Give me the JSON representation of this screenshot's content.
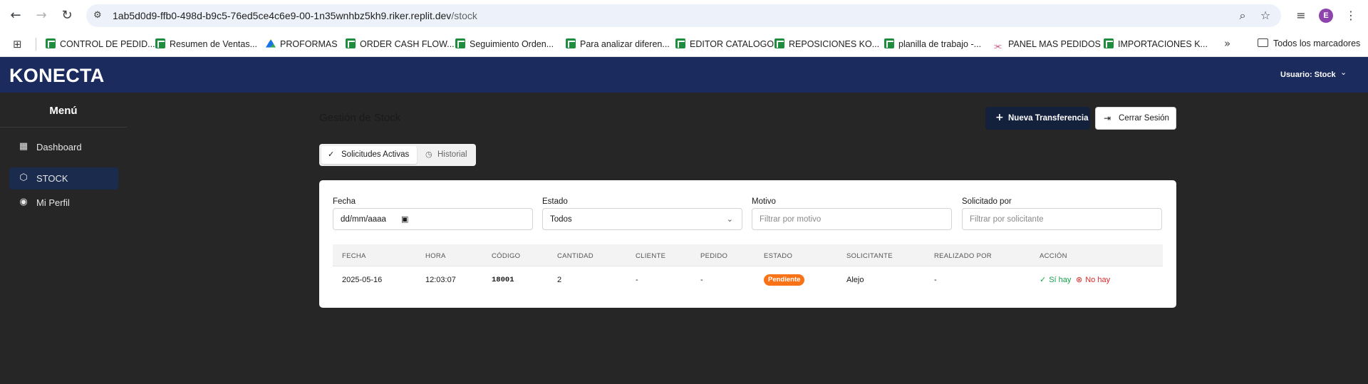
{
  "browser": {
    "url_host": "1ab5d0d9-ffb0-498d-b9c5-76ed5ce4c6e9-00-1n35wnhbz5kh9.riker.replit.dev",
    "url_path": "/stock",
    "avatar_letter": "E"
  },
  "bookmarks": {
    "items": [
      {
        "label": "CONTROL DE PEDID...",
        "icon": "sheets-icon"
      },
      {
        "label": "Resumen de Ventas...",
        "icon": "sheets-icon"
      },
      {
        "label": "PROFORMAS",
        "icon": "drive-icon"
      },
      {
        "label": "ORDER CASH FLOW...",
        "icon": "sheets-icon"
      },
      {
        "label": "Seguimiento Orden...",
        "icon": "sheets-icon"
      },
      {
        "label": "Para analizar diferen...",
        "icon": "sheets-icon"
      },
      {
        "label": "EDITOR CATALOGO",
        "icon": "sheets-icon"
      },
      {
        "label": "REPOSICIONES KO...",
        "icon": "sheets-icon"
      },
      {
        "label": "planilla de trabajo -...",
        "icon": "sheets-icon"
      },
      {
        "label": "PANEL MAS PEDIDOS",
        "icon": "panel-icon"
      },
      {
        "label": "IMPORTACIONES K...",
        "icon": "sheets-icon"
      }
    ],
    "all_bookmarks": "Todos los marcadores"
  },
  "header": {
    "logo": "KONECTA",
    "user_label": "Usuario: Stock",
    "brand_color": "#1b2b5e"
  },
  "sidebar": {
    "title": "Menú",
    "items": [
      {
        "label": "Dashboard",
        "icon": "dashboard-icon",
        "active": false
      },
      {
        "label": "STOCK",
        "icon": "box-icon",
        "active": true
      },
      {
        "label": "Mi Perfil",
        "icon": "user-circle-icon",
        "active": false
      }
    ]
  },
  "main": {
    "title": "Gestión de Stock",
    "new_transfer_label": "Nueva Transferencia",
    "logout_label": "Cerrar Sesión",
    "tabs": [
      {
        "label": "Solicitudes Activas",
        "active": true
      },
      {
        "label": "Historial",
        "active": false
      }
    ]
  },
  "filters": {
    "fecha": {
      "label": "Fecha",
      "value": "dd/mm/aaaa"
    },
    "estado": {
      "label": "Estado",
      "value": "Todos"
    },
    "motivo": {
      "label": "Motivo",
      "placeholder": "Filtrar por motivo"
    },
    "solicitado": {
      "label": "Solicitado por",
      "placeholder": "Filtrar por solicitante"
    }
  },
  "table": {
    "headers": [
      "FECHA",
      "HORA",
      "CÓDIGO",
      "CANTIDAD",
      "CLIENTE",
      "PEDIDO",
      "ESTADO",
      "SOLICITANTE",
      "REALIZADO POR",
      "ACCIÓN"
    ],
    "rows": [
      {
        "fecha": "2025-05-16",
        "hora": "12:03:07",
        "codigo": "18001",
        "cantidad": "2",
        "cliente": "-",
        "pedido": "-",
        "estado": "Pendiente",
        "solicitante": "Alejo",
        "realizado": "-",
        "action_yes": "Sí hay",
        "action_no": "No hay"
      }
    ],
    "status_color": "#f97316"
  }
}
